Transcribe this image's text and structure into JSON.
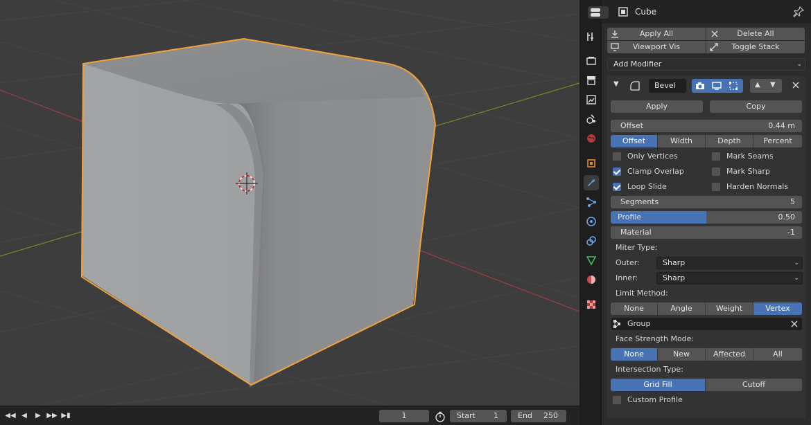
{
  "header": {
    "object_name": "Cube"
  },
  "toolbar": {
    "apply_all": "Apply All",
    "delete_all": "Delete All",
    "viewport_vis": "Viewport Vis",
    "toggle_stack": "Toggle Stack",
    "add_modifier": "Add Modifier"
  },
  "modifier": {
    "name": "Bevel",
    "apply": "Apply",
    "copy": "Copy",
    "offset_label": "Offset",
    "offset_value": "0.44 m",
    "width_types": [
      "Offset",
      "Width",
      "Depth",
      "Percent"
    ],
    "width_type_selected": "Offset",
    "options": {
      "only_vertices": "Only Vertices",
      "clamp_overlap": "Clamp Overlap",
      "loop_slide": "Loop Slide",
      "mark_seams": "Mark Seams",
      "mark_sharp": "Mark Sharp",
      "harden_normals": "Harden Normals"
    },
    "checked": {
      "only_vertices": false,
      "clamp_overlap": true,
      "loop_slide": true,
      "mark_seams": false,
      "mark_sharp": false,
      "harden_normals": false
    },
    "segments_label": "Segments",
    "segments_value": "5",
    "profile_label": "Profile",
    "profile_value": "0.50",
    "profile_fraction": 0.5,
    "material_label": "Material",
    "material_value": "-1",
    "miter_type_label": "Miter Type:",
    "outer_label": "Outer:",
    "outer_value": "Sharp",
    "inner_label": "Inner:",
    "inner_value": "Sharp",
    "limit_method_label": "Limit Method:",
    "limit_methods": [
      "None",
      "Angle",
      "Weight",
      "Vertex Group"
    ],
    "limit_method_selected": "Vertex Group",
    "vertex_group": "Group",
    "face_strength_label": "Face Strength Mode:",
    "face_strength_modes": [
      "None",
      "New",
      "Affected",
      "All"
    ],
    "face_strength_selected": "None",
    "intersection_label": "Intersection Type:",
    "intersection_types": [
      "Grid Fill",
      "Cutoff"
    ],
    "intersection_selected": "Grid Fill",
    "custom_profile": "Custom Profile",
    "custom_profile_checked": false
  },
  "timeline": {
    "current_frame": "1",
    "start_label": "Start",
    "start_value": "1",
    "end_label": "End",
    "end_value": "250"
  },
  "colors": {
    "accent": "#4772b3",
    "selection_outline": "#f2a03d",
    "viewport_bg": "#3d3d3d",
    "panel_bg": "#2c2c2c"
  },
  "tabs_icons": [
    "tool-icon",
    "render-icon",
    "output-icon",
    "view-layer-icon",
    "scene-icon",
    "world-icon",
    "object-icon",
    "modifier-icon",
    "particles-icon",
    "physics-icon",
    "constraints-icon",
    "data-icon",
    "material-icon",
    "texture-icon"
  ]
}
